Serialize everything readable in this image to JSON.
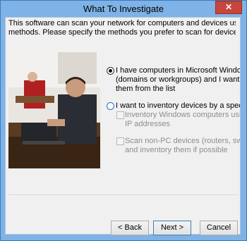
{
  "window": {
    "title": "What To Investigate",
    "close_glyph": "✕"
  },
  "intro_lines": [
    "This software can scan your network for computers and devices using various scanning",
    "methods. Please specify the methods you prefer to scan for devices:"
  ],
  "photo_icon": "office-worker-laptop-photo",
  "options": {
    "windows_network": {
      "selected": true,
      "lines": [
        "I have computers in Microsoft Windows Network",
        "(domains or workgroups) and I want to browse",
        "them from the list"
      ]
    },
    "ip_range": {
      "selected": false,
      "lines": [
        "I want to inventory devices by a specified IP range"
      ]
    },
    "inventory_windows": {
      "checked": false,
      "enabled": false,
      "lines": [
        "Inventory Windows computers using their",
        "IP addresses"
      ]
    },
    "scan_non_pc": {
      "checked": false,
      "enabled": false,
      "lines": [
        "Scan non-PC devices (routers, switches, etc.)",
        "and inventory them if possible"
      ]
    }
  },
  "buttons": {
    "back": "< Back",
    "next": "Next >",
    "cancel": "Cancel"
  },
  "colors": {
    "frame": "#7fb2e6",
    "close": "#c7453a"
  }
}
